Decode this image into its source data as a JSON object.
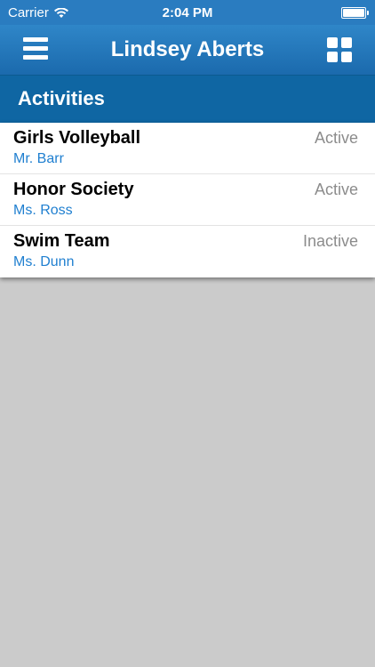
{
  "status_bar": {
    "carrier": "Carrier",
    "time": "2:04 PM",
    "wifi_icon": "wifi-icon",
    "battery_icon": "battery-icon"
  },
  "nav_bar": {
    "title": "Lindsey Aberts",
    "menu_icon": "hamburger-menu-icon",
    "grid_icon": "grid-icon",
    "color": "#1f73b6"
  },
  "section": {
    "title": "Activities",
    "color": "#0f66a3"
  },
  "activities": [
    {
      "name": "Girls Volleyball",
      "teacher": "Mr. Barr",
      "status": "Active"
    },
    {
      "name": "Honor Society",
      "teacher": "Ms. Ross",
      "status": "Active"
    },
    {
      "name": "Swim Team",
      "teacher": "Ms. Dunn",
      "status": "Inactive"
    }
  ]
}
